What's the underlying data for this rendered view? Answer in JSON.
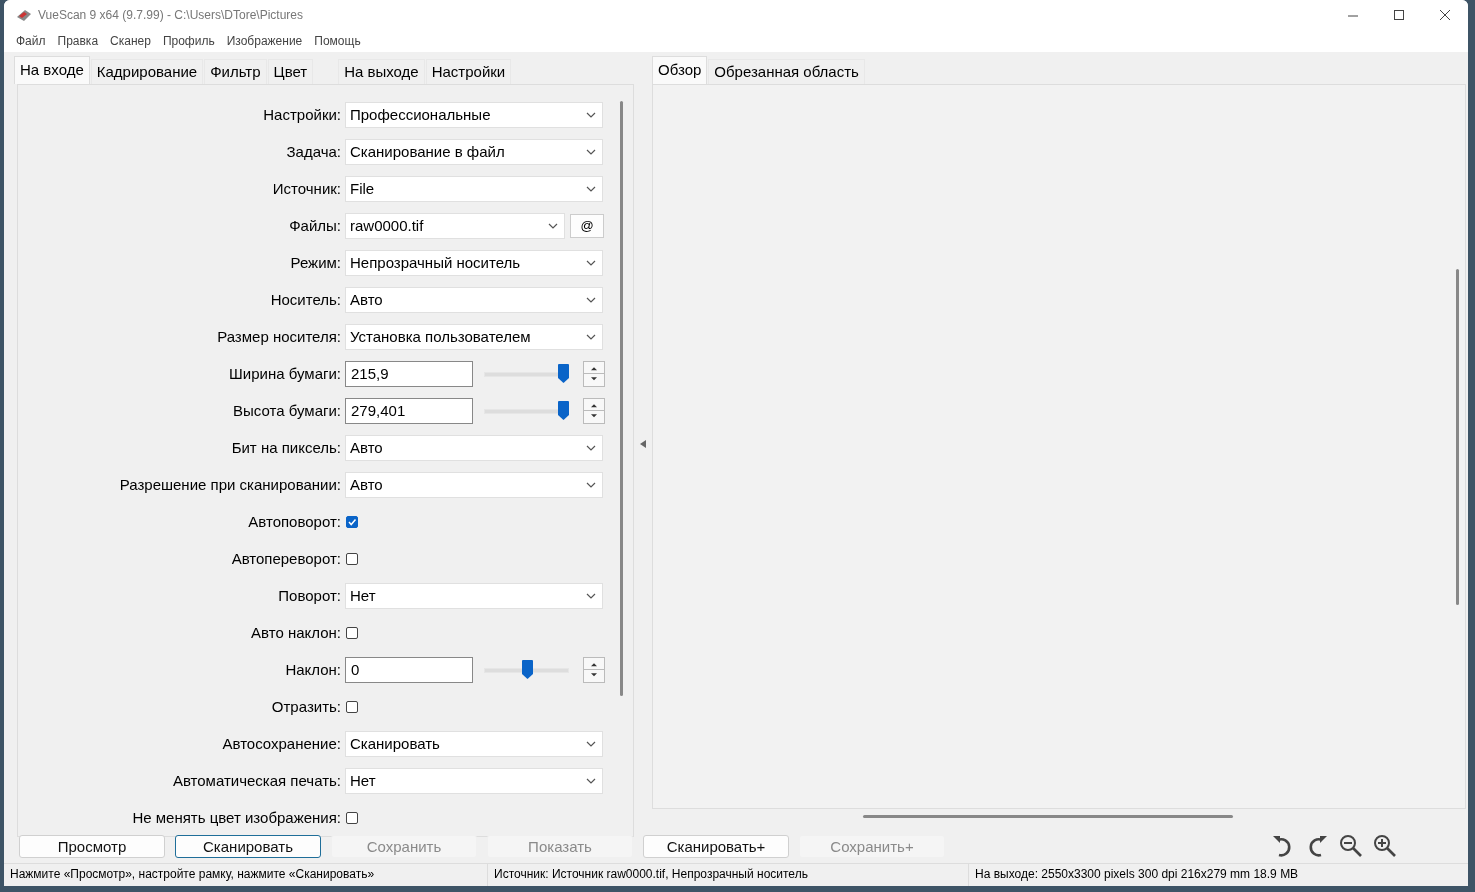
{
  "window": {
    "title": "VueScan 9 x64 (9.7.99) - C:\\Users\\DTore\\Pictures"
  },
  "menu": [
    "Файл",
    "Правка",
    "Сканер",
    "Профиль",
    "Изображение",
    "Помощь"
  ],
  "left_tabs": [
    {
      "label": "На входе",
      "selected": true
    },
    {
      "label": "Кадрирование",
      "selected": false
    },
    {
      "label": "Фильтр",
      "selected": false
    },
    {
      "label": "Цвет",
      "selected": false
    },
    {
      "label": "На выходе",
      "selected": false
    },
    {
      "label": "Настройки",
      "selected": false
    }
  ],
  "fields": [
    {
      "kind": "select",
      "label": "Настройки:",
      "value": "Профессиональные"
    },
    {
      "kind": "select",
      "label": "Задача:",
      "value": "Сканирование в файл"
    },
    {
      "kind": "select",
      "label": "Источник:",
      "value": "File"
    },
    {
      "kind": "select_button",
      "label": "Файлы:",
      "value": "raw0000.tif",
      "button": "@"
    },
    {
      "kind": "select",
      "label": "Режим:",
      "value": "Непрозрачный носитель"
    },
    {
      "kind": "select",
      "label": "Носитель:",
      "value": "Авто"
    },
    {
      "kind": "select",
      "label": "Размер носителя:",
      "value": "Установка пользователем"
    },
    {
      "kind": "number",
      "label": "Ширина бумаги:",
      "value": "215,9",
      "level": 0.93
    },
    {
      "kind": "number",
      "label": "Высота бумаги:",
      "value": "279,401",
      "level": 0.93
    },
    {
      "kind": "select",
      "label": "Бит на пиксель:",
      "value": "Авто"
    },
    {
      "kind": "select",
      "label": "Разрешение при сканировании:",
      "value": "Авто"
    },
    {
      "kind": "checkbox",
      "label": "Автоповорот:",
      "checked": true
    },
    {
      "kind": "checkbox",
      "label": "Автопереворот:",
      "checked": false
    },
    {
      "kind": "select",
      "label": "Поворот:",
      "value": "Нет"
    },
    {
      "kind": "checkbox",
      "label": "Авто наклон:",
      "checked": false
    },
    {
      "kind": "number",
      "label": "Наклон:",
      "value": "0",
      "level": 0.5
    },
    {
      "kind": "checkbox",
      "label": "Отразить:",
      "checked": false
    },
    {
      "kind": "select",
      "label": "Автосохранение:",
      "value": "Сканировать"
    },
    {
      "kind": "select",
      "label": "Автоматическая печать:",
      "value": "Нет"
    },
    {
      "kind": "checkbox",
      "label": "Не менять цвет изображения:",
      "checked": false
    }
  ],
  "right_tabs": [
    {
      "label": "Обзор",
      "selected": true
    },
    {
      "label": "Обрезанная область",
      "selected": false
    }
  ],
  "buttons": [
    {
      "label": "Просмотр",
      "disabled": false,
      "focused": false
    },
    {
      "label": "Сканировать",
      "disabled": false,
      "focused": true
    },
    {
      "label": "Сохранить",
      "disabled": true,
      "focused": false
    },
    {
      "label": "Показать",
      "disabled": true,
      "focused": false
    },
    {
      "label": "Сканировать+",
      "disabled": false,
      "focused": false
    },
    {
      "label": "Сохранить+",
      "disabled": true,
      "focused": false
    }
  ],
  "status_bar": [
    "Нажмите «Просмотр», настройте рамку, нажмите «Сканировать»",
    "Источник: Источник raw0000.tif, Непрозрачный носитель",
    "На выходе: 2550x3300 pixels 300 dpi 216x279 mm 18.9 MB"
  ]
}
